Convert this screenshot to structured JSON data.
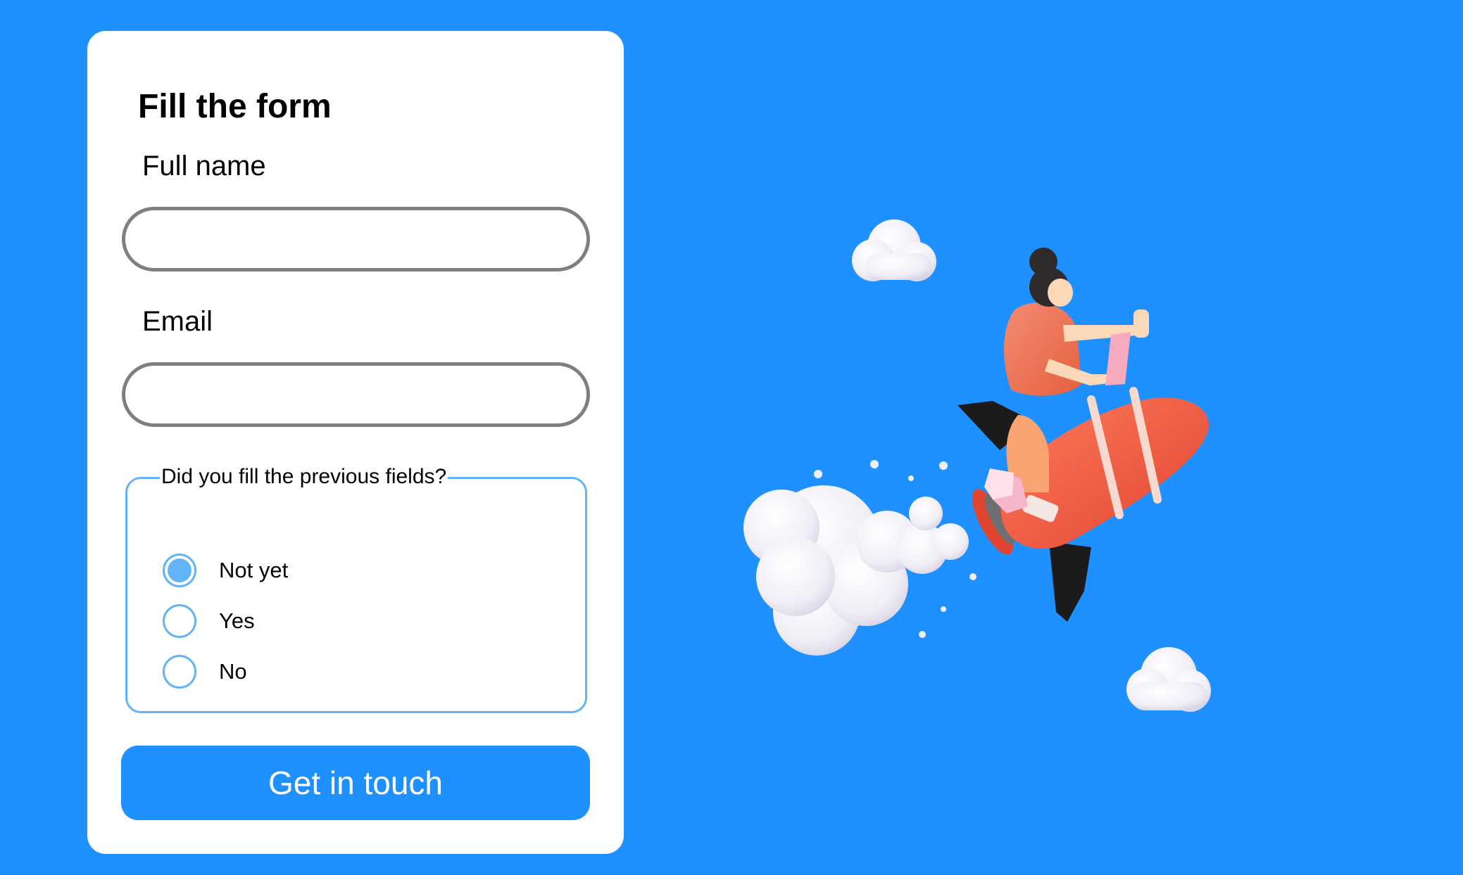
{
  "form": {
    "title": "Fill the form",
    "full_name": {
      "label": "Full name",
      "value": "",
      "placeholder": ""
    },
    "email": {
      "label": "Email",
      "value": "",
      "placeholder": ""
    },
    "question": {
      "legend": "Did you fill the previous fields?",
      "options": [
        {
          "label": "Not yet",
          "selected": true
        },
        {
          "label": "Yes",
          "selected": false
        },
        {
          "label": "No",
          "selected": false
        }
      ]
    },
    "submit_label": "Get in touch"
  },
  "colors": {
    "background": "#1e90ff",
    "card": "#ffffff",
    "input_border": "#7f7f7f",
    "radio_accent": "#63b3f8",
    "button": "#1e90ff",
    "button_text": "#ffffff"
  },
  "illustration": {
    "subject": "rocket-rider-illustration"
  }
}
